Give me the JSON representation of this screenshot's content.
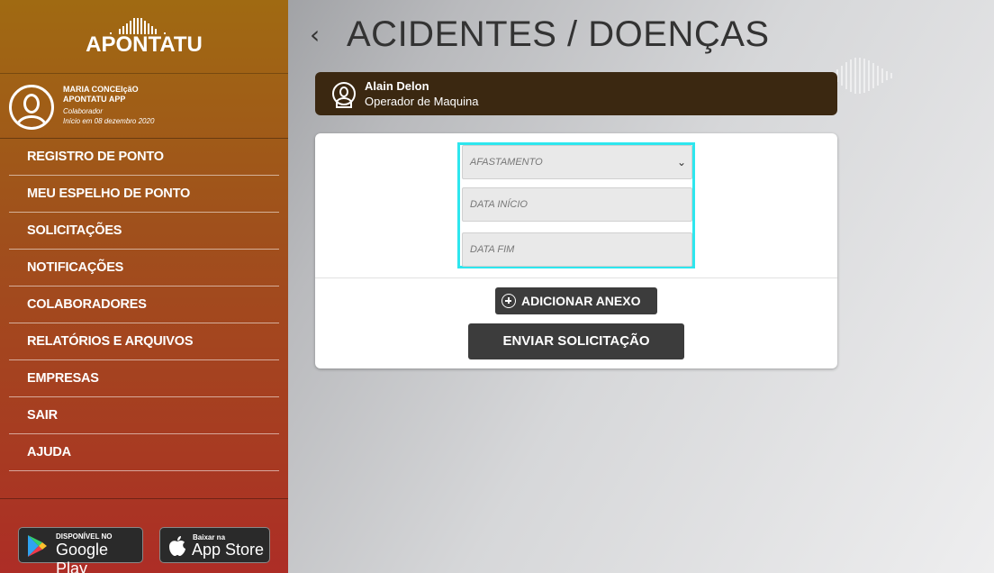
{
  "brand": {
    "name": "APONTATU"
  },
  "profile": {
    "name_line1": "MARIA CONCEIçãO",
    "name_line2": "APONTATU APP",
    "role": "Colaborador",
    "since": "Início em 08 dezembro 2020"
  },
  "nav": {
    "items": [
      {
        "label": "REGISTRO DE PONTO"
      },
      {
        "label": "MEU ESPELHO DE PONTO"
      },
      {
        "label": "SOLICITAÇÕES"
      },
      {
        "label": "NOTIFICAÇÕES"
      },
      {
        "label": "COLABORADORES"
      },
      {
        "label": "RELATÓRIOS E ARQUIVOS"
      },
      {
        "label": "EMPRESAS"
      },
      {
        "label": "SAIR"
      },
      {
        "label": "AJUDA"
      }
    ]
  },
  "stores": {
    "google_small": "DISPONÍVEL NO",
    "google_big": "Google Play",
    "apple_small": "Baixar na",
    "apple_big": "App Store"
  },
  "header": {
    "back_icon": "chevron-left-icon",
    "title": "ACIDENTES / DOENÇAS"
  },
  "employee": {
    "name": "Alain Delon",
    "role": "Operador de Maquina"
  },
  "form": {
    "type_placeholder": "AFASTAMENTO",
    "start_placeholder": "DATA INÍCIO",
    "end_placeholder": "DATA FIM",
    "add_attachment_label": "ADICIONAR ANEXO",
    "submit_label": "ENVIAR SOLICITAÇÃO"
  },
  "colors": {
    "sidebar_top": "#a06a12",
    "sidebar_bottom": "#ad2d26",
    "employee_bar": "#3b2811",
    "button": "#3c3c3c",
    "focus_outline": "#2ee6ee"
  }
}
